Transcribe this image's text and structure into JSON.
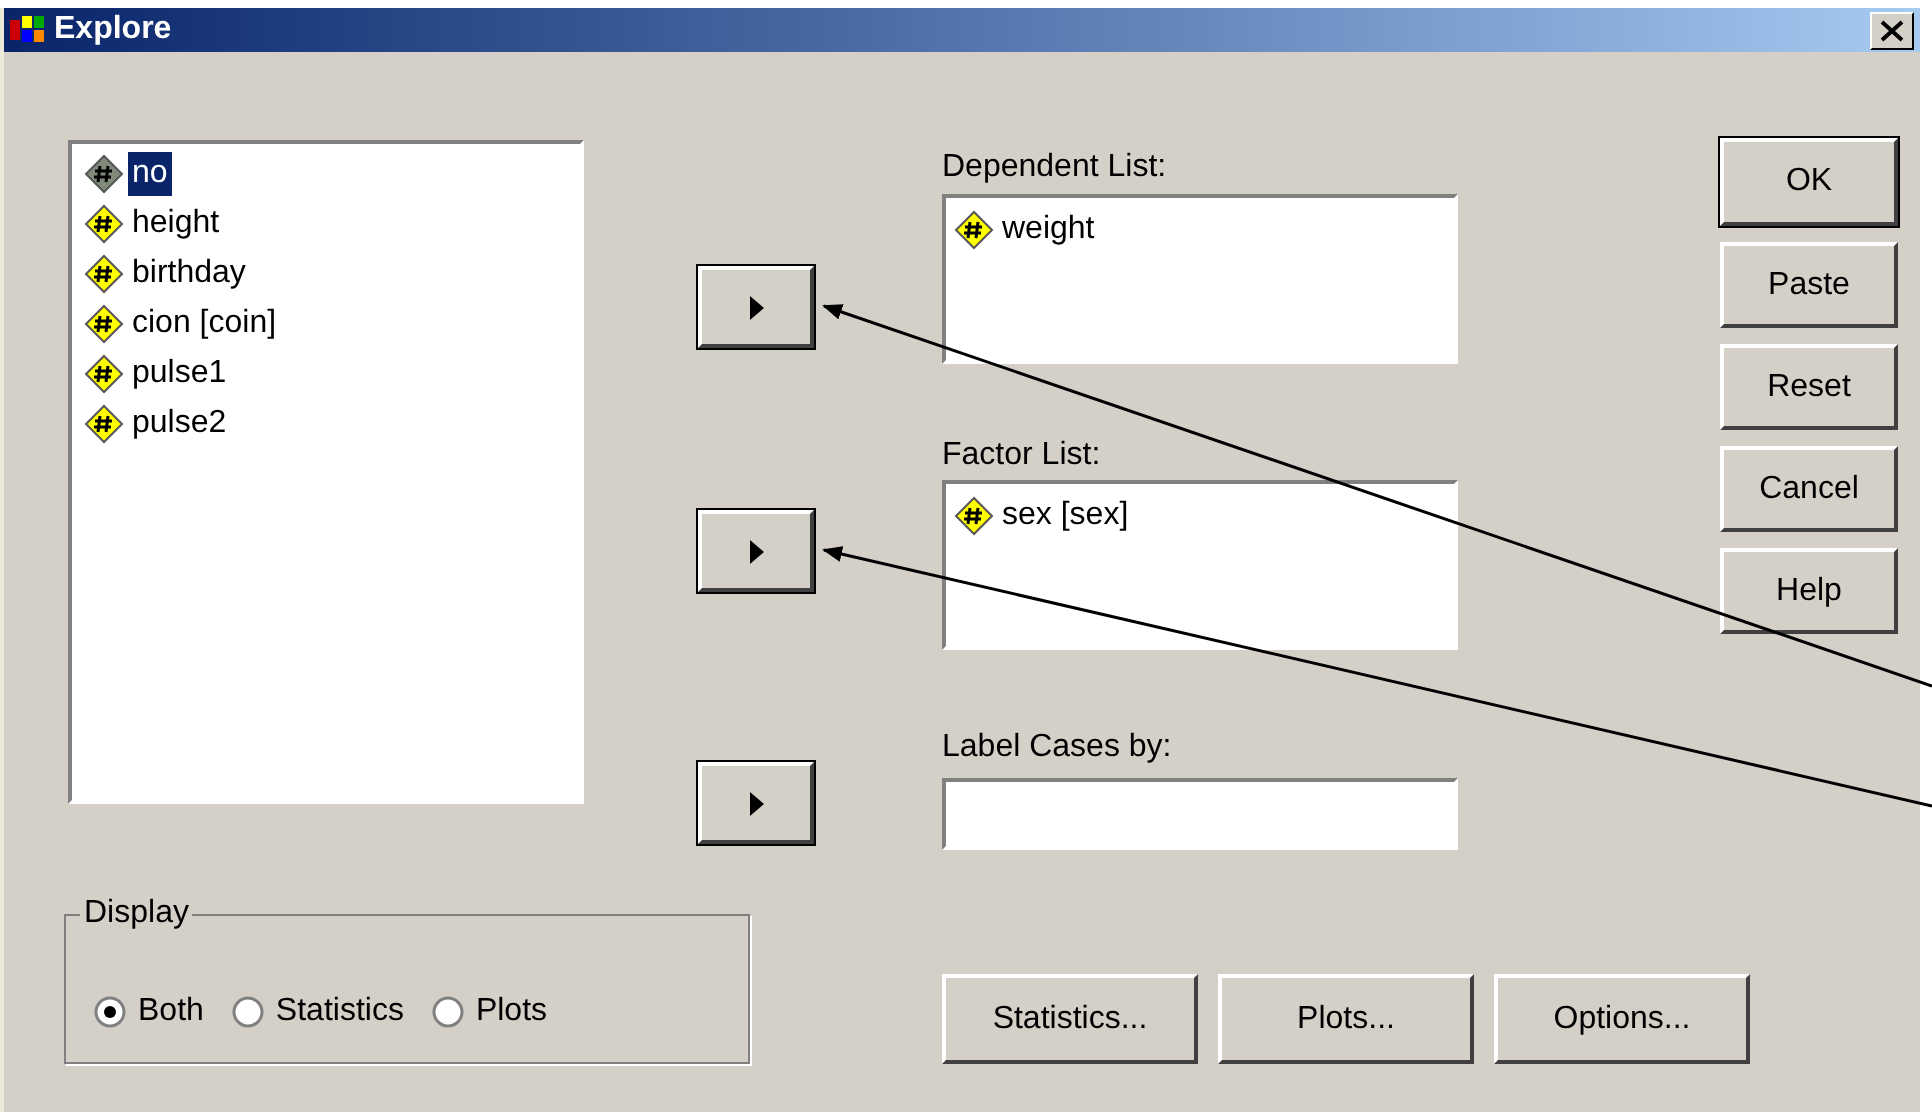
{
  "window": {
    "title": "Explore"
  },
  "variables": [
    {
      "label": "no",
      "selected": true
    },
    {
      "label": "height",
      "selected": false
    },
    {
      "label": "birthday",
      "selected": false
    },
    {
      "label": "cion [coin]",
      "selected": false
    },
    {
      "label": "pulse1",
      "selected": false
    },
    {
      "label": "pulse2",
      "selected": false
    }
  ],
  "dependent_list": {
    "label": "Dependent List:",
    "items": [
      "weight"
    ]
  },
  "factor_list": {
    "label": "Factor List:",
    "items": [
      "sex [sex]"
    ]
  },
  "label_cases": {
    "label": "Label Cases by:"
  },
  "display": {
    "legend": "Display",
    "options": [
      {
        "label": "Both",
        "selected": true
      },
      {
        "label": "Statistics",
        "selected": false
      },
      {
        "label": "Plots",
        "selected": false
      }
    ]
  },
  "side_buttons": [
    {
      "label": "OK",
      "default": true
    },
    {
      "label": "Paste",
      "default": false
    },
    {
      "label": "Reset",
      "default": false
    },
    {
      "label": "Cancel",
      "default": false
    },
    {
      "label": "Help",
      "default": false
    }
  ],
  "bottom_buttons": [
    "Statistics...",
    "Plots...",
    "Options..."
  ]
}
